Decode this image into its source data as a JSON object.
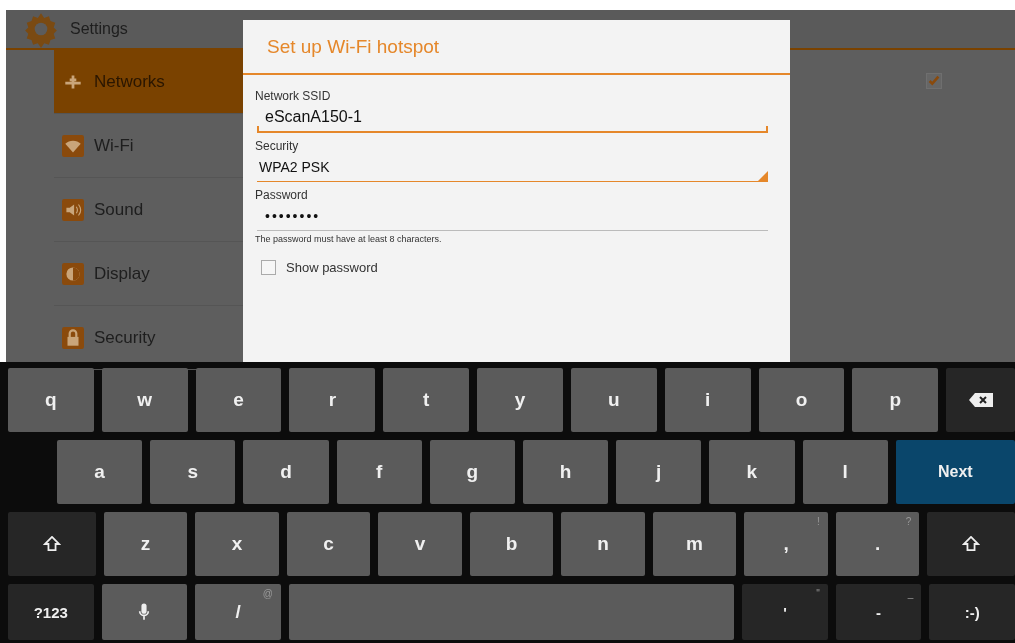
{
  "app_bar": {
    "title": "Settings"
  },
  "nav": [
    {
      "label": "Networks",
      "selected": true
    },
    {
      "label": "Wi-Fi",
      "selected": false
    },
    {
      "label": "Sound",
      "selected": false
    },
    {
      "label": "Display",
      "selected": false
    },
    {
      "label": "Security",
      "selected": false
    }
  ],
  "background_checkbox": {
    "checked": true
  },
  "dialog": {
    "title": "Set up Wi-Fi hotspot",
    "fields": [
      {
        "kind": "text",
        "label": "Network SSID",
        "value": "eScanA150-1"
      },
      {
        "kind": "dropdown",
        "label": "Security",
        "value": "WPA2 PSK"
      },
      {
        "kind": "password",
        "label": "Password",
        "value": "••••••••",
        "hint": "The password must have at least 8 characters."
      }
    ],
    "show_password": {
      "label": "Show password",
      "checked": false
    }
  },
  "keyboard": {
    "rows": [
      {
        "keys": [
          {
            "kind": "letter",
            "label": "q"
          },
          {
            "kind": "letter",
            "label": "w"
          },
          {
            "kind": "letter",
            "label": "e"
          },
          {
            "kind": "letter",
            "label": "r"
          },
          {
            "kind": "letter",
            "label": "t"
          },
          {
            "kind": "letter",
            "label": "y"
          },
          {
            "kind": "letter",
            "label": "u"
          },
          {
            "kind": "letter",
            "label": "i"
          },
          {
            "kind": "letter",
            "label": "o"
          },
          {
            "kind": "letter",
            "label": "p"
          },
          {
            "kind": "backspace"
          }
        ]
      },
      {
        "keys": [
          {
            "kind": "letter",
            "label": "a"
          },
          {
            "kind": "letter",
            "label": "s"
          },
          {
            "kind": "letter",
            "label": "d"
          },
          {
            "kind": "letter",
            "label": "f"
          },
          {
            "kind": "letter",
            "label": "g"
          },
          {
            "kind": "letter",
            "label": "h"
          },
          {
            "kind": "letter",
            "label": "j"
          },
          {
            "kind": "letter",
            "label": "k"
          },
          {
            "kind": "letter",
            "label": "l"
          },
          {
            "kind": "primary",
            "label": "Next"
          }
        ]
      },
      {
        "keys": [
          {
            "kind": "shift"
          },
          {
            "kind": "letter",
            "label": "z"
          },
          {
            "kind": "letter",
            "label": "x"
          },
          {
            "kind": "letter",
            "label": "c"
          },
          {
            "kind": "letter",
            "label": "v"
          },
          {
            "kind": "letter",
            "label": "b"
          },
          {
            "kind": "letter",
            "label": "n"
          },
          {
            "kind": "letter",
            "label": "m"
          },
          {
            "kind": "letter",
            "label": ",",
            "alt": "!"
          },
          {
            "kind": "letter",
            "label": ".",
            "alt": "?"
          },
          {
            "kind": "shift"
          }
        ]
      },
      {
        "keys": [
          {
            "kind": "function",
            "label": "?123"
          },
          {
            "kind": "mic"
          },
          {
            "kind": "letter",
            "label": "/",
            "alt": "@"
          },
          {
            "kind": "space"
          },
          {
            "kind": "function",
            "label": "'",
            "alt": "\""
          },
          {
            "kind": "function",
            "label": "-",
            "alt": "_"
          },
          {
            "kind": "function",
            "label": ":-)"
          }
        ]
      }
    ]
  }
}
